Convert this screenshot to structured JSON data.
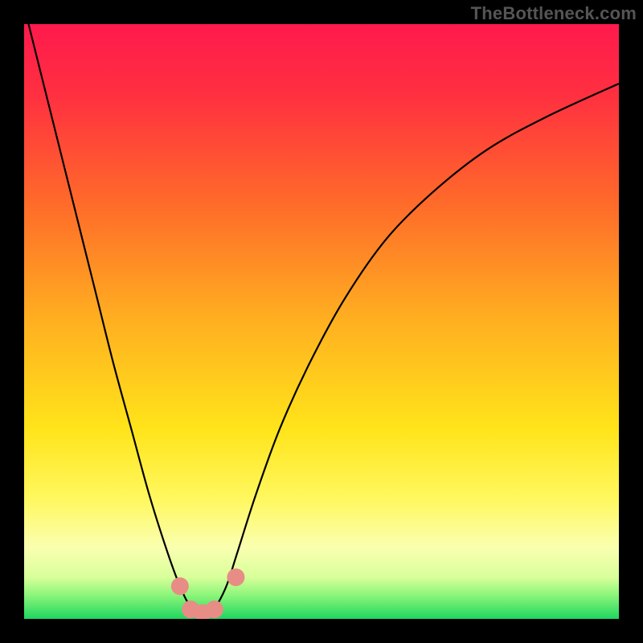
{
  "watermark": "TheBottleneck.com",
  "chart_data": {
    "type": "line",
    "title": "",
    "xlabel": "",
    "ylabel": "",
    "xlim": [
      0,
      1
    ],
    "ylim": [
      0,
      1
    ],
    "grid": false,
    "legend": false,
    "notes": "Axes unlabeled in source; x and y normalized 0–1. y is bottleneck severity (0 at bottom = good/green, 1 at top = bad/red). Single V-shaped curve with minimum near x≈0.30.",
    "gradient_stops": [
      {
        "offset": 0.0,
        "color": "#ff1a4d"
      },
      {
        "offset": 0.12,
        "color": "#ff3040"
      },
      {
        "offset": 0.3,
        "color": "#ff6a2a"
      },
      {
        "offset": 0.5,
        "color": "#ffb020"
      },
      {
        "offset": 0.68,
        "color": "#ffe41a"
      },
      {
        "offset": 0.8,
        "color": "#fff860"
      },
      {
        "offset": 0.88,
        "color": "#faffb0"
      },
      {
        "offset": 0.93,
        "color": "#d8ff9a"
      },
      {
        "offset": 0.96,
        "color": "#8cf57a"
      },
      {
        "offset": 1.0,
        "color": "#1fd660"
      }
    ],
    "series": [
      {
        "name": "bottleneck-curve",
        "x": [
          0.0,
          0.03,
          0.06,
          0.09,
          0.12,
          0.15,
          0.18,
          0.21,
          0.24,
          0.262,
          0.28,
          0.3,
          0.32,
          0.34,
          0.358,
          0.39,
          0.43,
          0.48,
          0.54,
          0.61,
          0.69,
          0.78,
          0.88,
          1.0
        ],
        "y": [
          1.03,
          0.91,
          0.79,
          0.67,
          0.55,
          0.43,
          0.32,
          0.21,
          0.115,
          0.055,
          0.02,
          0.005,
          0.018,
          0.055,
          0.11,
          0.21,
          0.32,
          0.43,
          0.54,
          0.64,
          0.72,
          0.79,
          0.845,
          0.9
        ]
      }
    ],
    "markers": [
      {
        "x": 0.262,
        "y": 0.055
      },
      {
        "x": 0.28,
        "y": 0.016
      },
      {
        "x": 0.3,
        "y": 0.01
      },
      {
        "x": 0.32,
        "y": 0.016
      },
      {
        "x": 0.356,
        "y": 0.07
      }
    ]
  }
}
